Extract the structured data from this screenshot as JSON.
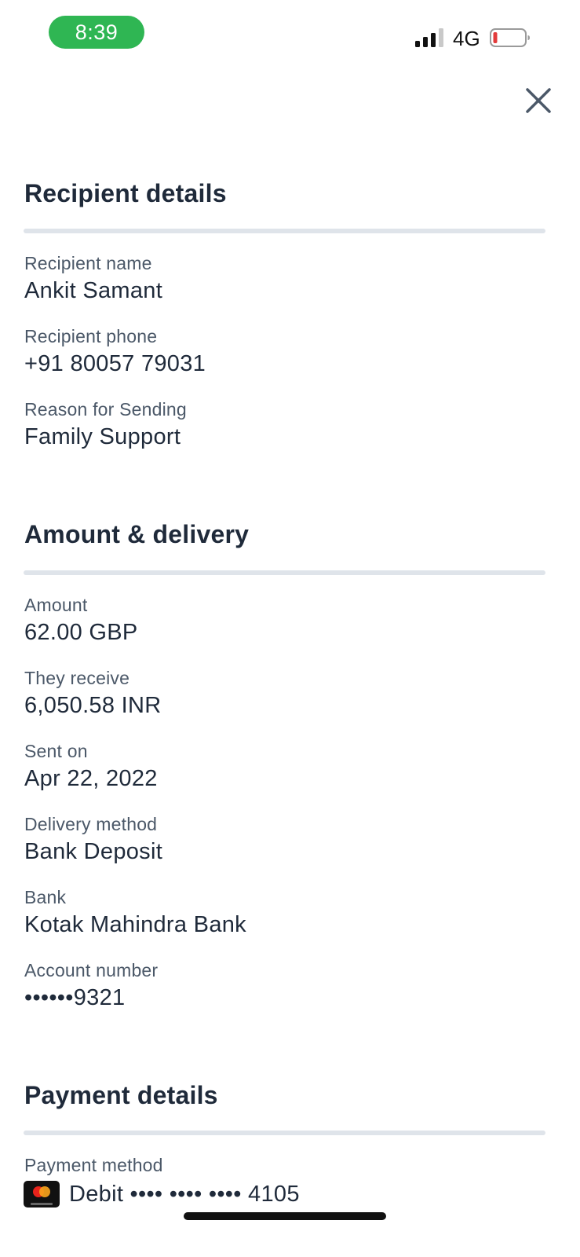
{
  "status_bar": {
    "time": "8:39",
    "network": "4G",
    "time_pill_color": "#2fb653",
    "battery_level_color": "#e23b3b",
    "icons": [
      "signal-icon",
      "battery-icon"
    ]
  },
  "close_icon": "close-icon",
  "recipient_section": {
    "title": "Recipient details",
    "fields": [
      {
        "label": "Recipient name",
        "value": "Ankit Samant"
      },
      {
        "label": "Recipient phone",
        "value": "+91 80057 79031"
      },
      {
        "label": "Reason for Sending",
        "value": "Family Support"
      }
    ]
  },
  "amount_section": {
    "title": "Amount & delivery",
    "fields": [
      {
        "label": "Amount",
        "value": "62.00 GBP"
      },
      {
        "label": "They receive",
        "value": "6,050.58 INR"
      },
      {
        "label": "Sent on",
        "value": "Apr 22, 2022"
      },
      {
        "label": "Delivery method",
        "value": "Bank Deposit"
      },
      {
        "label": "Bank",
        "value": "Kotak Mahindra Bank"
      },
      {
        "label": "Account number",
        "value": "••••••9321"
      }
    ]
  },
  "payment_section": {
    "title": "Payment details",
    "fields": [
      {
        "label": "Payment method",
        "value": "Debit •••• •••• •••• 4105",
        "icon": "mastercard-icon"
      }
    ]
  }
}
